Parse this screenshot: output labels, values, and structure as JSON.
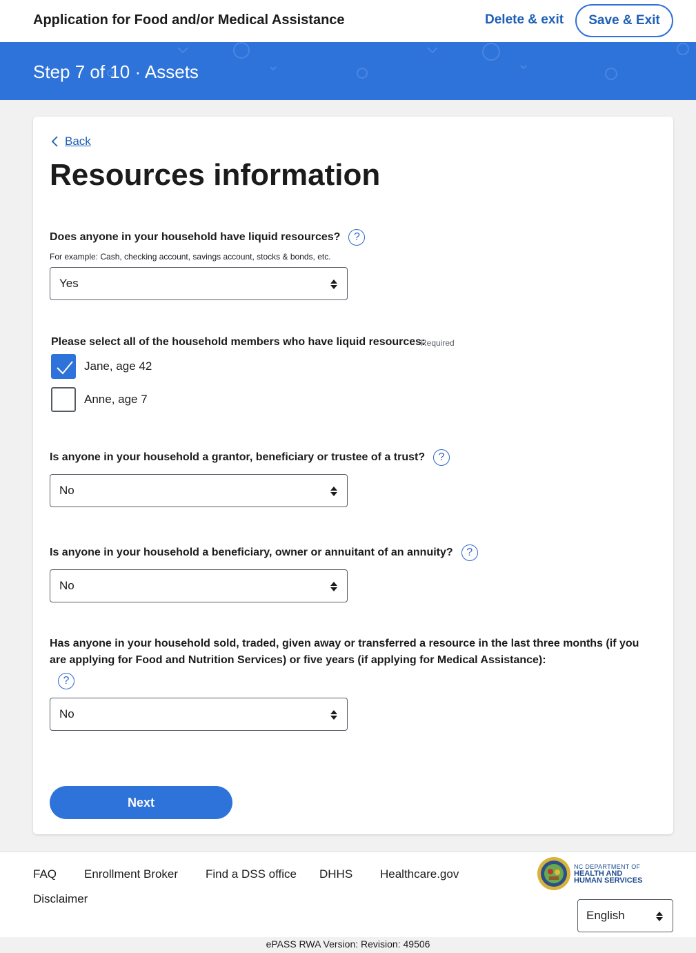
{
  "header": {
    "title": "Application for Food and/or Medical Assistance",
    "delete_label": "Delete & exit",
    "save_label": "Save & Exit"
  },
  "banner": {
    "step": "Step 7 of 10 · Assets"
  },
  "card": {
    "back_label": "Back",
    "title": "Resources information",
    "q1": {
      "label": "Does anyone in your household have liquid resources?",
      "hint": "For example: Cash, checking account, savings account, stocks & bonds, etc.",
      "value": "Yes"
    },
    "members": {
      "label": "Please select all of the household members who have liquid resources:",
      "required": "Required",
      "items": [
        {
          "label": "Jane, age 42",
          "checked": true
        },
        {
          "label": "Anne, age 7",
          "checked": false
        }
      ]
    },
    "q2": {
      "label": "Is anyone in your household a grantor, beneficiary or trustee of a trust?",
      "value": "No"
    },
    "q3": {
      "label": "Is anyone in your household a beneficiary, owner or annuitant of an annuity?",
      "value": "No"
    },
    "q4": {
      "label": "Has anyone in your household sold, traded, given away or transferred a resource in the last three months (if you are applying for Food and Nutrition Services) or five years (if applying for Medical Assistance):",
      "value": "No"
    },
    "help_glyph": "?",
    "next_label": "Next"
  },
  "footer": {
    "links": [
      "FAQ",
      "Enrollment Broker",
      "Find a DSS office",
      "DHHS",
      "Healthcare.gov",
      "Disclaimer"
    ],
    "logo_line1": "NC DEPARTMENT OF",
    "logo_line2": "HEALTH AND",
    "logo_line3": "HUMAN SERVICES",
    "language": "English",
    "version": "ePASS RWA Version: Revision: 49506"
  },
  "colors": {
    "primary": "#2e73da",
    "link": "#1d5fb5",
    "background": "#f1f1f1"
  },
  "icons": {
    "back": "chevron-left-icon",
    "help": "question-circle-icon",
    "select": "sort-arrows-icon",
    "check": "checkmark-icon"
  }
}
